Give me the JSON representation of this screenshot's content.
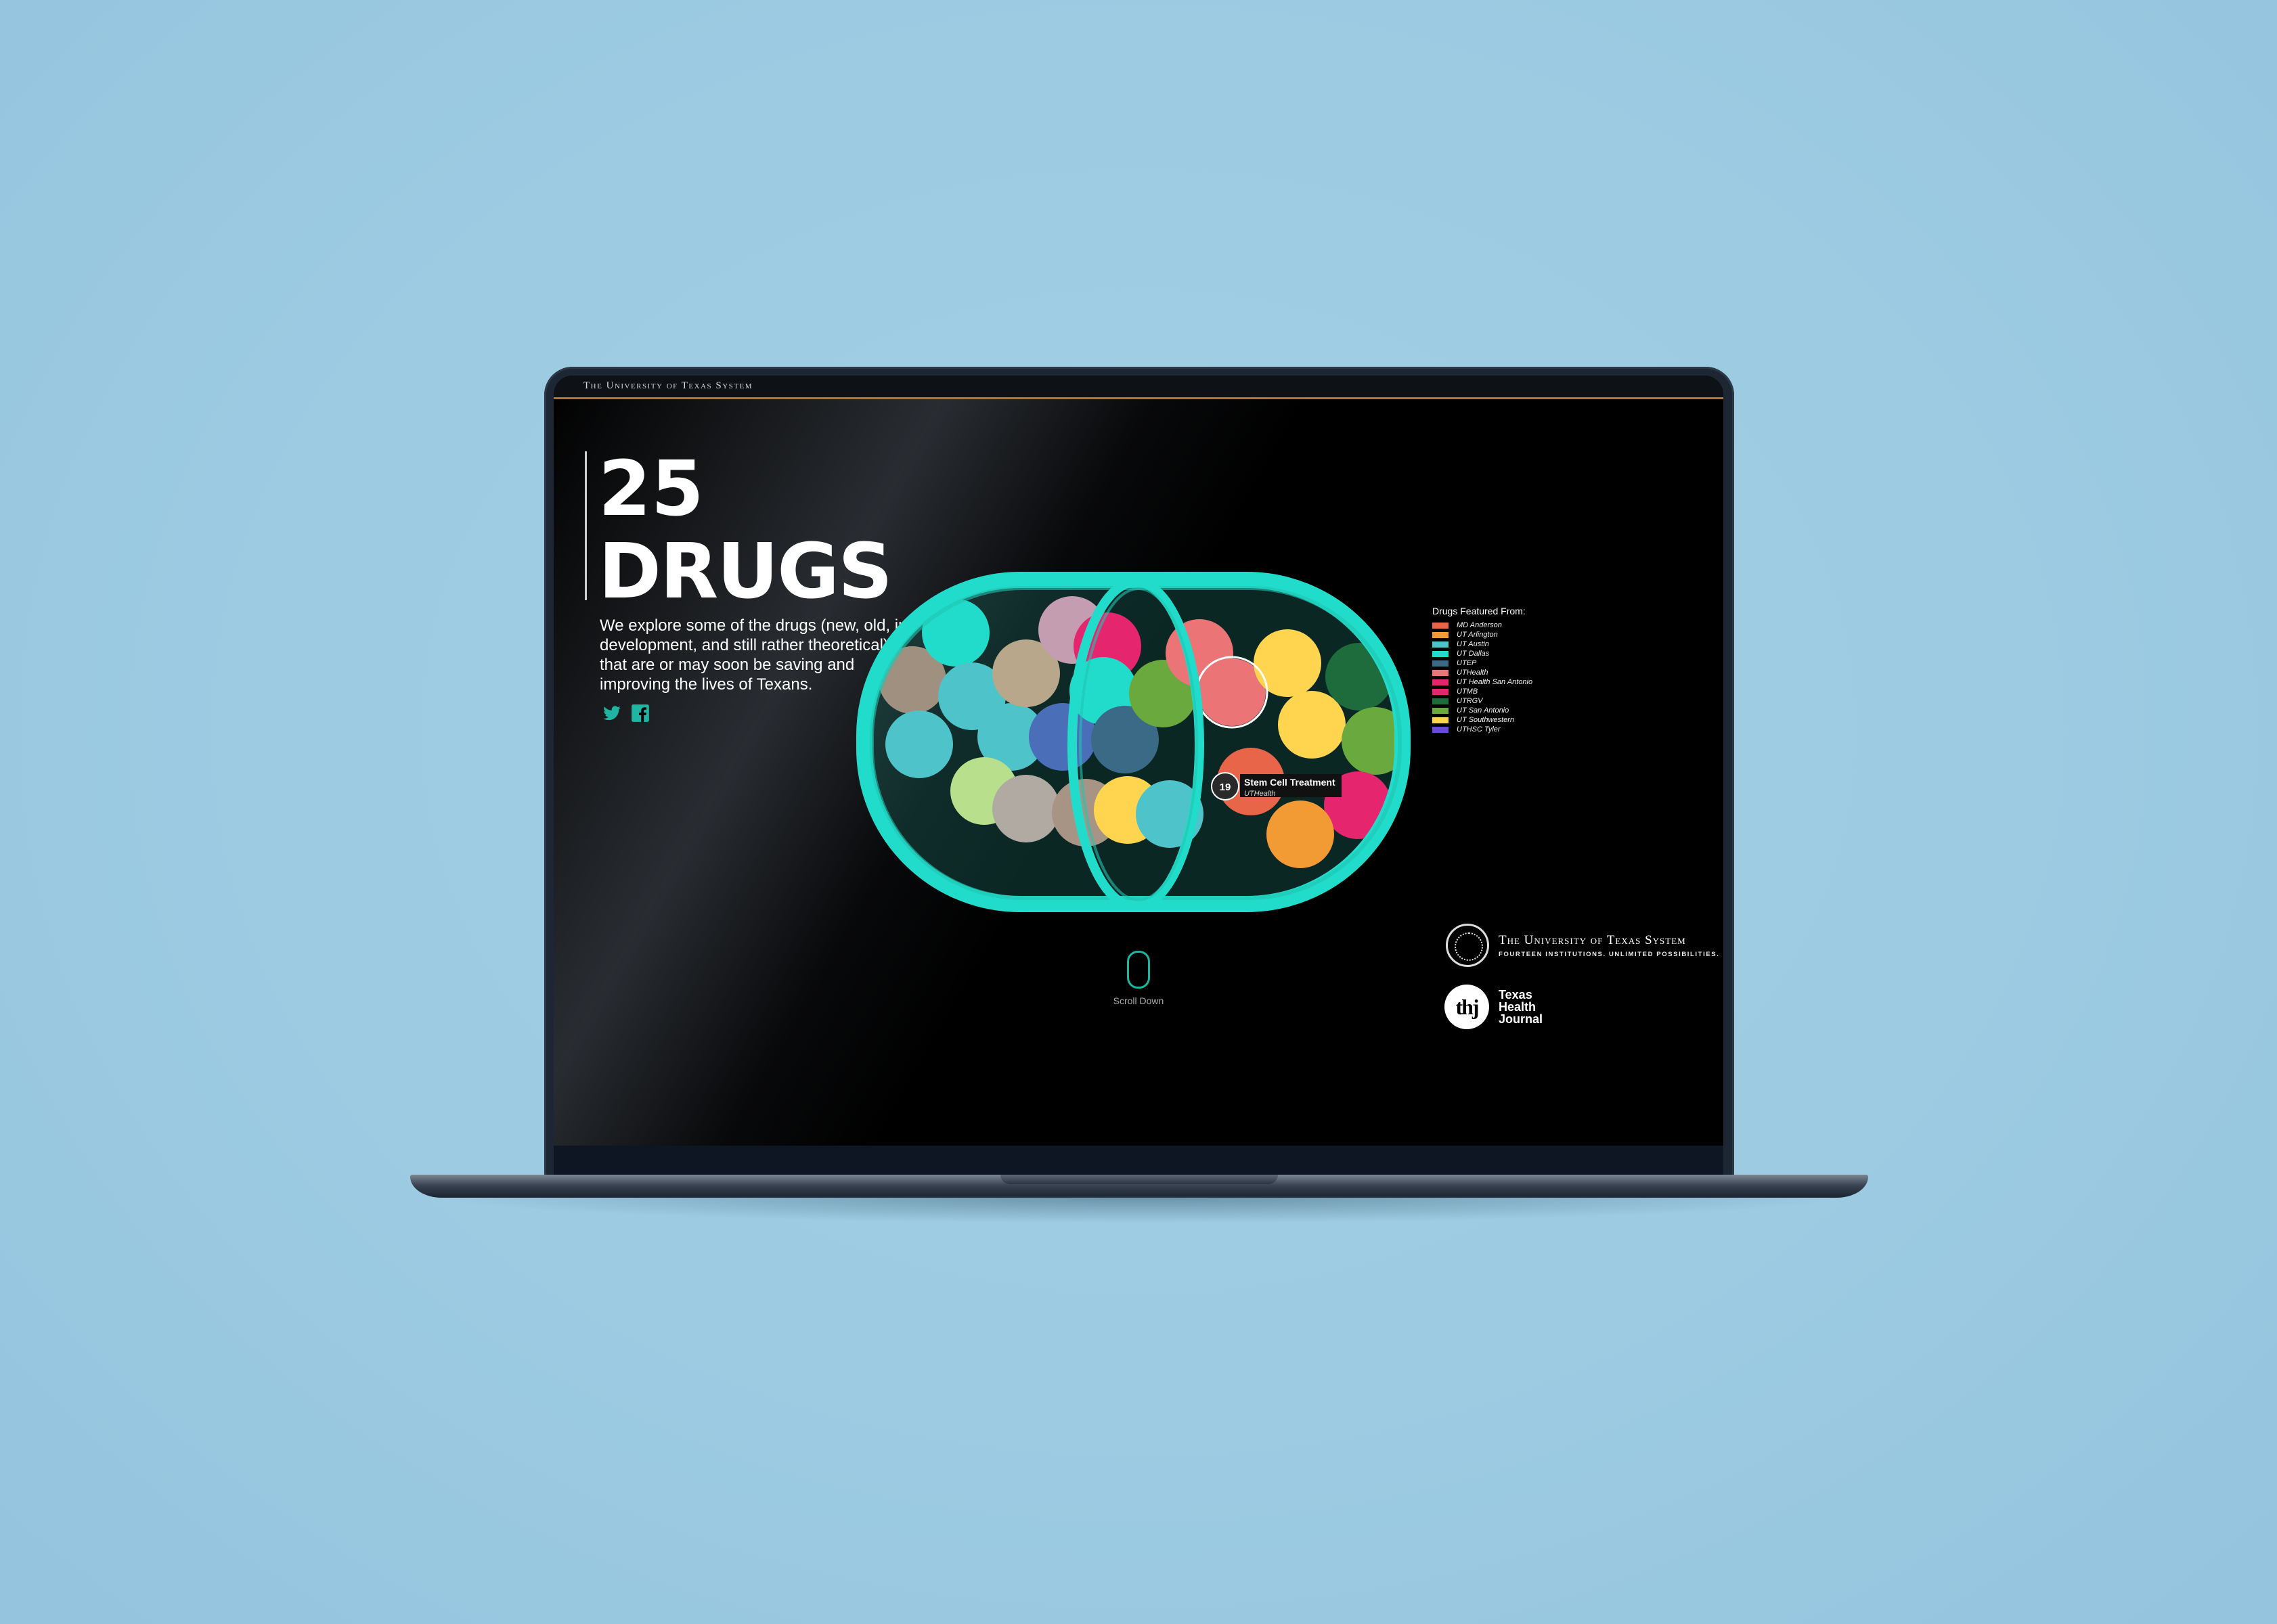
{
  "header": {
    "brand": "The University of Texas System"
  },
  "hero": {
    "title_number": "25",
    "title_word": "DRUGS",
    "intro": "We explore some of the drugs (new, old, in development, and still rather theoretical) that are or may soon be saving and improving the lives of Texans."
  },
  "social": {
    "twitter_icon": "twitter-icon",
    "facebook_icon": "facebook-icon"
  },
  "tooltip": {
    "number": "19",
    "title": "Stem Cell Treatment",
    "institution": "UTHealth"
  },
  "legend": {
    "title": "Drugs Featured From:",
    "items": [
      {
        "label": "MD Anderson",
        "color": "#e8654a"
      },
      {
        "label": "UT Arlington",
        "color": "#f29a34"
      },
      {
        "label": "UT Austin",
        "color": "#4ec3c9"
      },
      {
        "label": "UT Dallas",
        "color": "#22dccb"
      },
      {
        "label": "UTEP",
        "color": "#3a6a85"
      },
      {
        "label": "UTHealth",
        "color": "#ea7476"
      },
      {
        "label": "UT Health San Antonio",
        "color": "#e5256d"
      },
      {
        "label": "UTMB",
        "color": "#e5256d"
      },
      {
        "label": "UTRGV",
        "color": "#1e6b3c"
      },
      {
        "label": "UT San Antonio",
        "color": "#6aa93d"
      },
      {
        "label": "UT Southwestern",
        "color": "#ffd54f"
      },
      {
        "label": "UTHSC Tyler",
        "color": "#6a4bd3"
      }
    ]
  },
  "scroll": {
    "label": "Scroll Down"
  },
  "footer_logos": {
    "uts_name": "The University of Texas System",
    "uts_tagline": "FOURTEEN INSTITUTIONS. UNLIMITED POSSIBILITIES.",
    "thj_badge": "thj",
    "thj_line1": "Texas",
    "thj_line2": "Health",
    "thj_line3": "Journal"
  },
  "colors": {
    "accent": "#22dccb",
    "topbar_rule": "#b7742b"
  }
}
